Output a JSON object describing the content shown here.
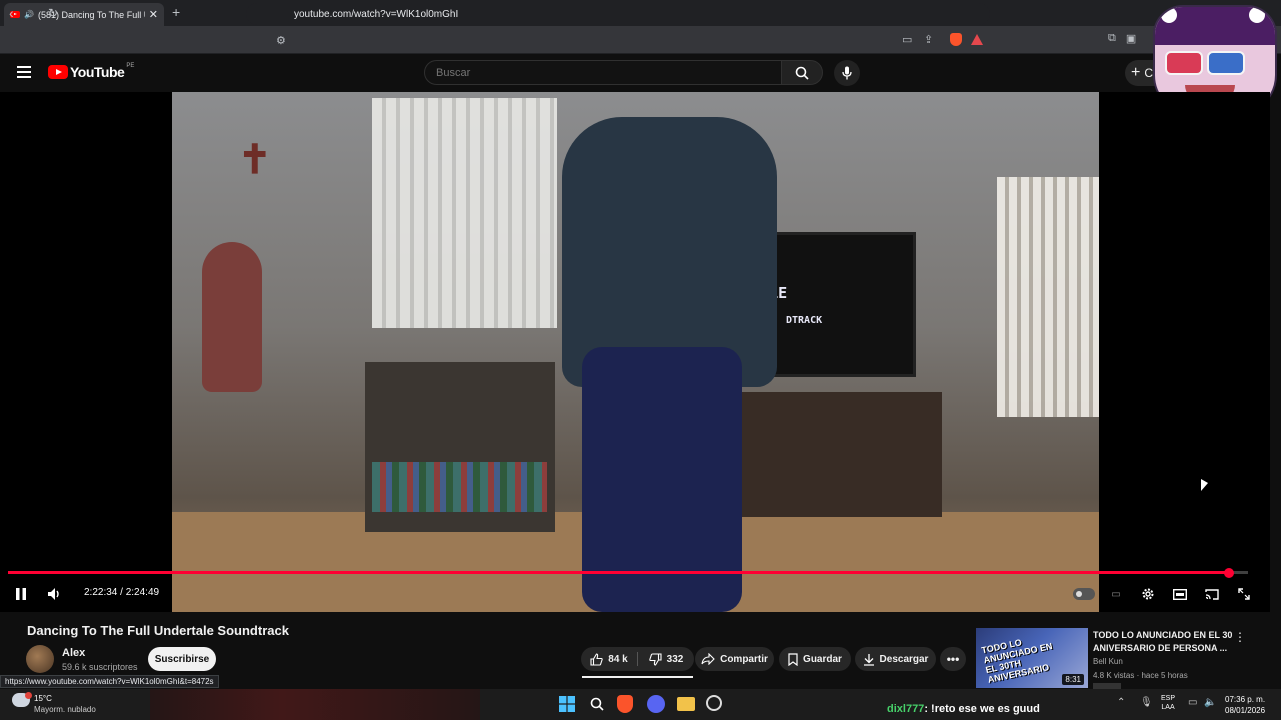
{
  "browser": {
    "tab_title": "(581) Dancing To The Full Une",
    "tab_close": "✕",
    "new_tab": "+",
    "url": "youtube.com/watch?v=WlK1ol0mGhI"
  },
  "youtube": {
    "logo_text": "YouTube",
    "country_code": "PE",
    "search_placeholder": "Buscar",
    "create_label": "C"
  },
  "player": {
    "time_display": "2:22:34 / 2:24:49",
    "progress_fraction": 0.985,
    "tv_line1": "RTALE",
    "tv_line2": "DTRACK"
  },
  "video": {
    "title": "Dancing To The Full Undertale Soundtrack",
    "channel_name": "Alex",
    "subscribers": "59.6 k suscriptores",
    "subscribe_label": "Suscribirse",
    "likes": "84 k",
    "dislikes": "332",
    "share_label": "Compartir",
    "save_label": "Guardar",
    "download_label": "Descargar"
  },
  "recommendation": {
    "title": "TODO LO ANUNCIADO EN EL 30 ANIVERSARIO DE PERSONA ...",
    "channel": "Bell Kun",
    "meta": "4.8 K vistas · hace 5 horas",
    "duration": "8:31",
    "thumb_text": "TODO LO ANUNCIADO EN EL 30TH ANIVERSARIO"
  },
  "status_link": "https://www.youtube.com/watch?v=WlK1ol0mGhI&t=8472s",
  "taskbar": {
    "temperature": "15°C",
    "weather": "Mayorm. nublado",
    "chat_user": "dixl777",
    "chat_message": ": !reto ese we es guud",
    "lang_top": "ESP",
    "lang_bottom": "LAA",
    "time": "07:36 p. m.",
    "date": "08/01/2026"
  },
  "colors": {
    "progress": "#ff0033",
    "background": "#0f0f0f",
    "chat_user": "#47d16a"
  }
}
